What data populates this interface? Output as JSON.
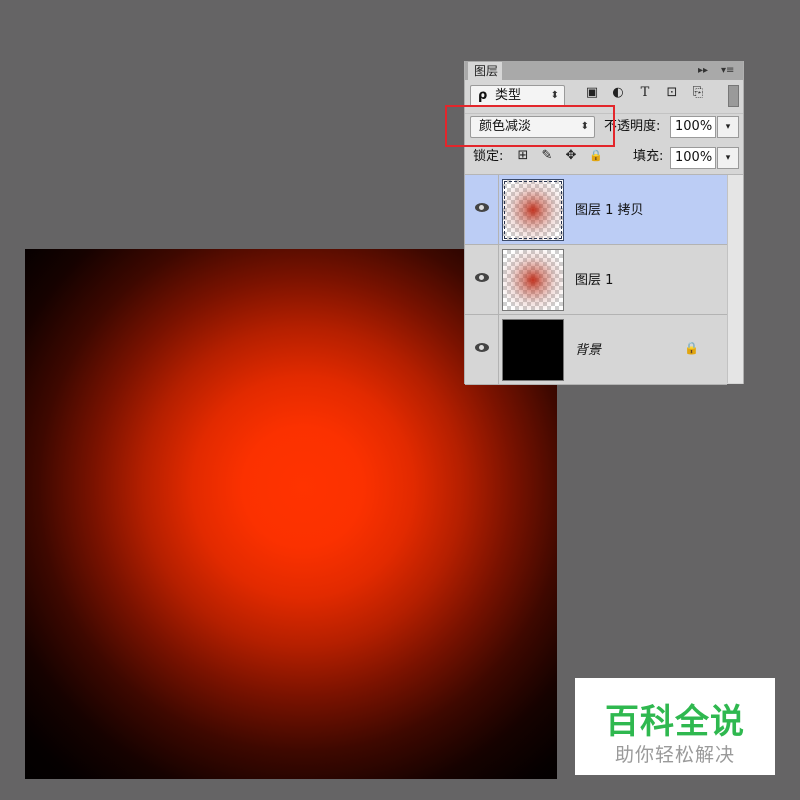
{
  "canvas": {
    "glow_color": "#ff3300"
  },
  "panel": {
    "tab_label": "图层",
    "collapse_glyph": "▸▸",
    "menu_glyph": "▾≡",
    "filter": {
      "label": "类型",
      "search_glyph": "ρ",
      "arrow": "⬍"
    },
    "filter_icons": [
      "image-filter-icon",
      "adjustment-filter-icon",
      "text-filter-icon",
      "shape-filter-icon",
      "smart-object-filter-icon"
    ],
    "filter_glyphs": [
      "▣",
      "◐",
      "T",
      "⊡",
      "⎘"
    ],
    "blend_mode": {
      "value": "颜色减淡",
      "arrow": "⬍"
    },
    "opacity": {
      "label": "不透明度:",
      "value": "100%"
    },
    "lock": {
      "label": "锁定:"
    },
    "lock_glyphs": [
      "⊞",
      "✎",
      "✥",
      "🔒"
    ],
    "fill": {
      "label": "填充:",
      "value": "100%"
    },
    "dropdown_glyph": "▾"
  },
  "layers": [
    {
      "name": "图层 1 拷贝",
      "selected": true
    },
    {
      "name": "图层 1",
      "selected": false
    },
    {
      "name": "背景",
      "selected": false,
      "locked": true,
      "lock_glyph": "🔒"
    }
  ],
  "highlight_color": "#e3262b",
  "watermark": {
    "title": "百科全说",
    "subtitle": "助你轻松解决"
  }
}
